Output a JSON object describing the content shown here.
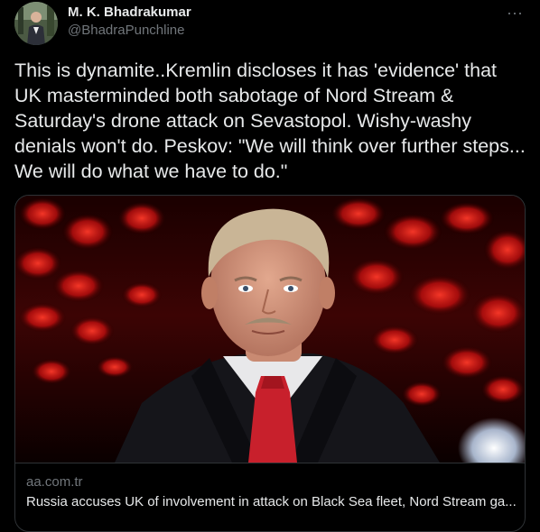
{
  "tweet": {
    "author": {
      "display_name": "M. K. Bhadrakumar",
      "handle": "@BhadraPunchline"
    },
    "more_label": "···",
    "text": "This is dynamite..Kremlin discloses it has 'evidence' that UK masterminded both sabotage of Nord Stream & Saturday's drone attack on Sevastopol. Wishy-washy denials won't do. Peskov: \"We will think over further steps... We will do what we have to do.\"",
    "card": {
      "domain": "aa.com.tr",
      "title": "Russia accuses UK of involvement in attack on Black Sea fleet, Nord Stream ga..."
    }
  },
  "colors": {
    "background": "#000000",
    "primary_text": "#e7e9ea",
    "secondary_text": "#71767b",
    "border": "#2f3336",
    "tie_red": "#c8202c",
    "backdrop_red": "#d81818"
  }
}
